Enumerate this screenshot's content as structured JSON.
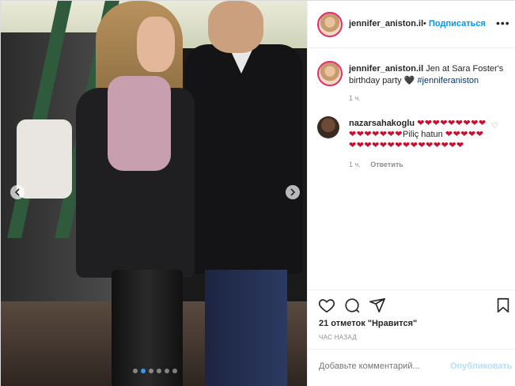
{
  "header": {
    "username": "jennifer_aniston.il",
    "separator": "•",
    "follow_label": "Подписаться",
    "more_label": "•••"
  },
  "caption": {
    "username": "jennifer_aniston.il",
    "text": "Jen at Sara Foster's birthday party 🖤 ",
    "hashtag": "#jenniferaniston",
    "time": "1 ч."
  },
  "comment": {
    "username": "nazarsahakoglu",
    "hearts_before": "❤❤❤❤❤❤❤❤❤❤❤❤❤❤❤❤",
    "text": "Piliç hatun",
    "hearts_after": "❤❤❤❤❤❤❤❤❤❤❤❤❤❤❤❤❤❤❤❤",
    "time": "1 ч.",
    "reply_label": "Ответить"
  },
  "actions": {
    "likes": "21 отметок \"Нравится\"",
    "time_ago": "ЧАС НАЗАД"
  },
  "add_comment": {
    "placeholder": "Добавьте комментарий...",
    "post_label": "Опубликовать"
  },
  "media": {
    "icons": [
      "chevron-left-icon",
      "chevron-right-icon"
    ],
    "carousel_count": 6,
    "carousel_active": 1
  },
  "colors": {
    "accent": "#0095f6",
    "heart": "#c8102e",
    "hashtag": "#00376b",
    "muted": "#8e8e8e"
  }
}
